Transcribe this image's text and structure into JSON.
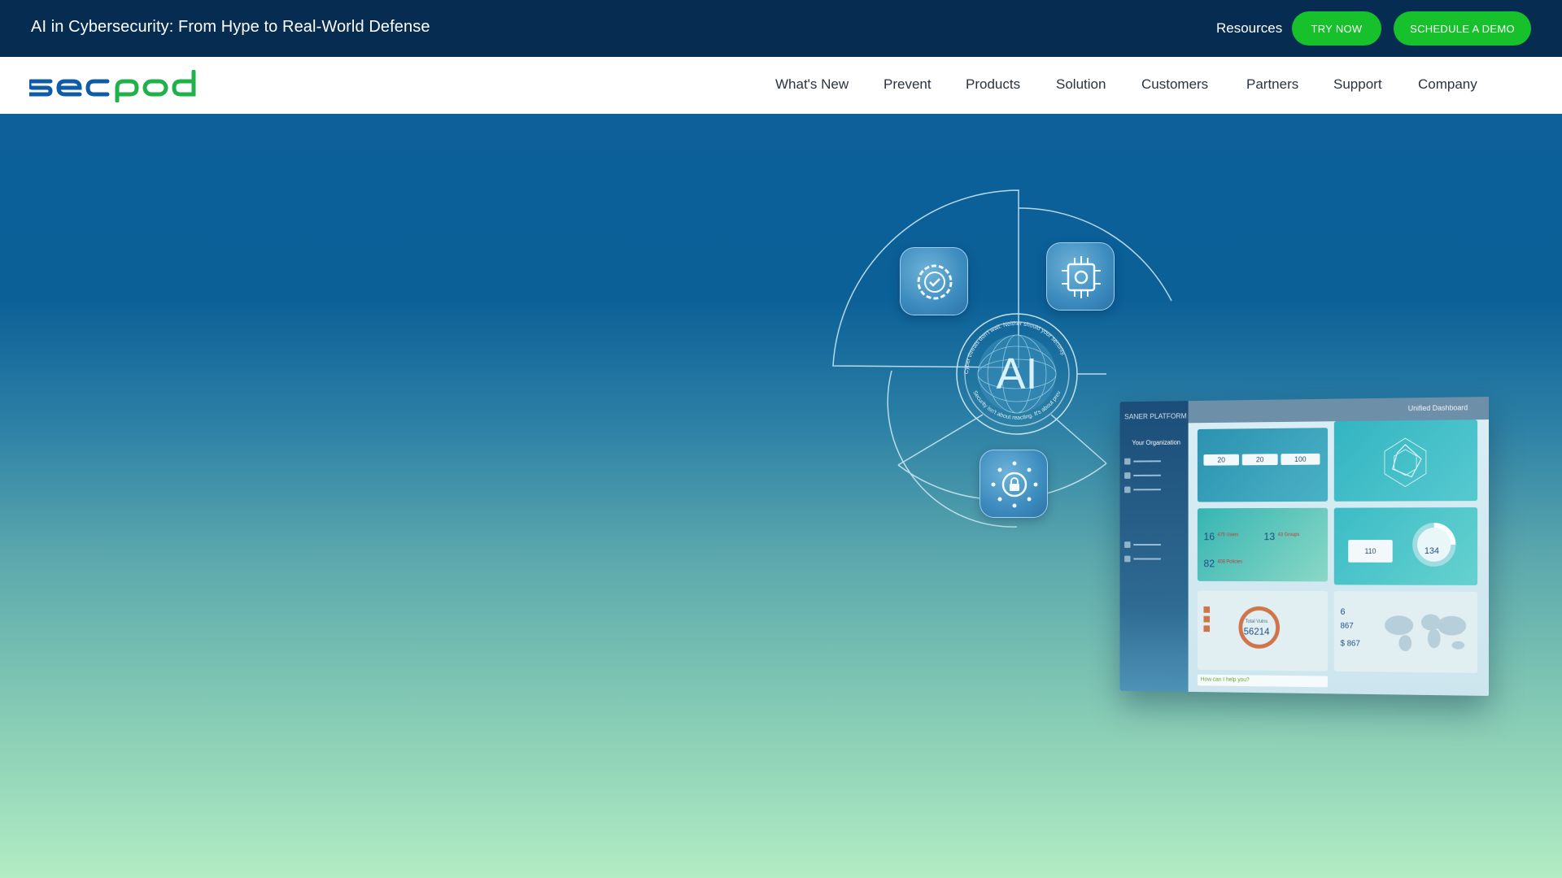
{
  "topbar": {
    "announcement": "AI in Cybersecurity: From Hype to Real-World Defense",
    "resources_label": "Resources",
    "try_now_label": "TRY NOW",
    "schedule_demo_label": "SCHEDULE A DEMO",
    "accent_color": "#17c12b",
    "background_color": "#062c52"
  },
  "navbar": {
    "logo_text": "secpod",
    "items": [
      {
        "label": "What's New"
      },
      {
        "label": "Prevent"
      },
      {
        "label": "Products"
      },
      {
        "label": "Solution"
      },
      {
        "label": "Customers"
      },
      {
        "label": "Partners"
      },
      {
        "label": "Support"
      },
      {
        "label": "Company"
      }
    ]
  },
  "hero": {
    "illustration": {
      "center_label": "AI",
      "ring_text_top": "Cyber threats don't wait. Neither should your security.",
      "ring_text_bottom": "Security isn't about reacting. It's about preventing.",
      "icons": [
        "gear-check-icon",
        "chip-gear-icon",
        "network-lock-icon"
      ]
    },
    "dashboard": {
      "platform_label": "SANER PLATFORM",
      "title": "Unified Dashboard",
      "org_label": "Your Organization",
      "stats": {
        "vulns": "20",
        "compliance": "20",
        "tasks": "100",
        "users_count": "16",
        "users_label": "475 Users",
        "groups_count": "13",
        "groups_label": "43 Groups",
        "policies_count": "82",
        "policies_label": "408 Policies",
        "gauge_small": "110",
        "gauge_value": "134",
        "donut_total": "56214",
        "total_label": "Total Vulns",
        "stat_six": "6",
        "stat_867": "867",
        "cost": "$ 867"
      },
      "assistant_placeholder": "How can I help you?"
    }
  }
}
